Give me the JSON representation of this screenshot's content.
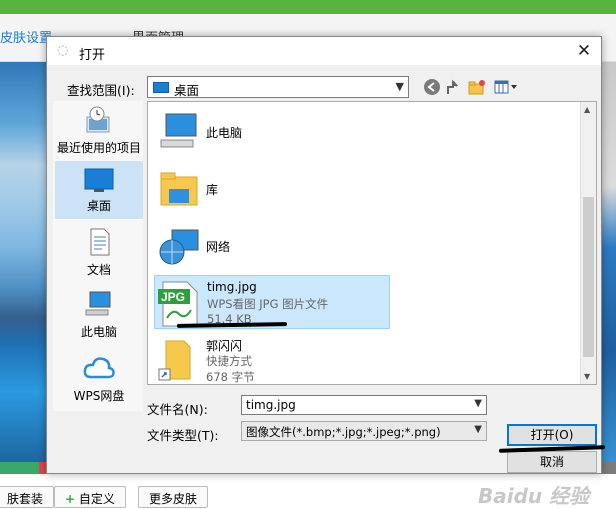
{
  "background": {
    "tabs": [
      "皮肤设置",
      "界面管理"
    ],
    "bottom_buttons": [
      "肤套装",
      "自定义",
      "更多皮肤"
    ],
    "watermark": "Baidu 经验",
    "stripe_colors": [
      "#3aa868",
      "#e4434f",
      "#e06a8c",
      "#d4519e",
      "#8a4fb5",
      "#5a5ab8",
      "#4a78c8",
      "#3f9bd6",
      "#36b3c4",
      "#36b59a",
      "#62b84a",
      "#9bc446",
      "#d9c23e",
      "#e8a23a",
      "#e0703c",
      "#7c7c7c"
    ]
  },
  "dialog": {
    "title": "打开",
    "close_glyph": "✕",
    "look_in": {
      "label": "查找范围(I):",
      "value": "桌面"
    },
    "places": [
      {
        "label": "最近使用的项目",
        "icon": "recent-icon"
      },
      {
        "label": "桌面",
        "icon": "desktop-icon",
        "selected": true
      },
      {
        "label": "文档",
        "icon": "documents-icon"
      },
      {
        "label": "此电脑",
        "icon": "computer-icon"
      },
      {
        "label": "WPS网盘",
        "icon": "cloud-icon"
      }
    ],
    "files": [
      {
        "name": "此电脑",
        "icon": "computer-icon"
      },
      {
        "name": "库",
        "icon": "library-icon"
      },
      {
        "name": "网络",
        "icon": "network-icon"
      },
      {
        "name": "timg.jpg",
        "type": "WPS看图 JPG 图片文件",
        "size": "51.4 KB",
        "icon": "jpg-file-icon",
        "selected": true
      },
      {
        "name": "郭闪闪",
        "type": "快捷方式",
        "size": "678 字节",
        "icon": "shortcut-folder-icon"
      }
    ],
    "filename": {
      "label": "文件名(N):",
      "value": "timg.jpg"
    },
    "filetype": {
      "label": "文件类型(T):",
      "value": "图像文件(*.bmp;*.jpg;*.jpeg;*.png)"
    },
    "open_button": "打开(O)",
    "cancel_button": "取消",
    "jpg_badge": "JPG"
  }
}
